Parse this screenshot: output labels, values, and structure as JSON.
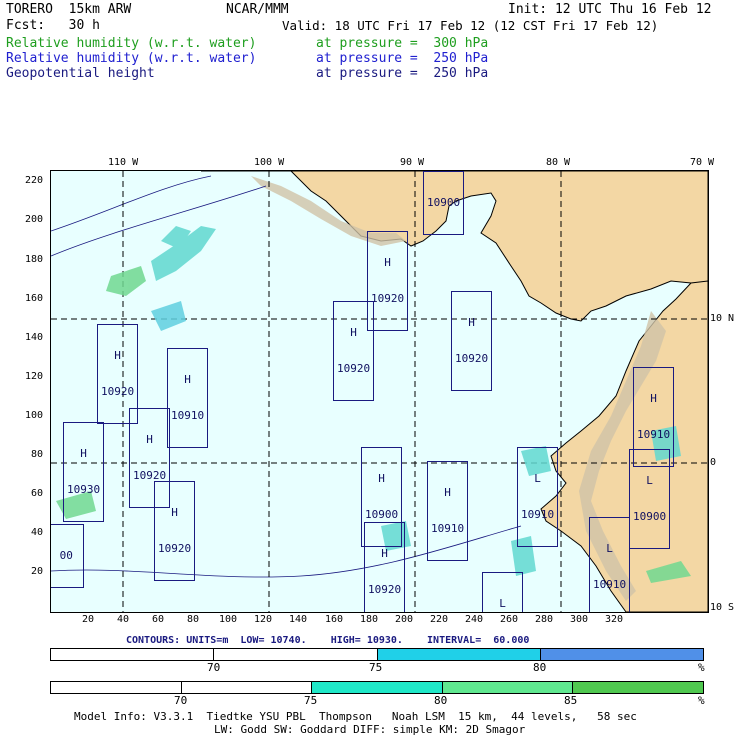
{
  "header": {
    "model": "TORERO  15km ARW",
    "org": "NCAR/MMM",
    "init": "Init: 12 UTC Thu 16 Feb 12",
    "fcst": "Fcst:   30 h",
    "valid": "Valid: 18 UTC Fri 17 Feb 12 (12 CST Fri 17 Feb 12)",
    "fields": [
      {
        "name": "Relative humidity (w.r.t. water)",
        "level": "at pressure =  300 hPa",
        "color": "#1e9e1e"
      },
      {
        "name": "Relative humidity (w.r.t. water)",
        "level": "at pressure =  250 hPa",
        "color": "#2020d0"
      },
      {
        "name": "Geopotential height",
        "level": "at pressure =  250 hPa",
        "color": "#1a1a80"
      }
    ]
  },
  "map": {
    "lon_labels": [
      "110 W",
      "100 W",
      "90 W",
      "80 W",
      "70 W"
    ],
    "lat_labels": [
      "10 N",
      "0",
      "10 S"
    ],
    "y_ticks": [
      "220",
      "200",
      "180",
      "160",
      "140",
      "120",
      "100",
      "80",
      "60",
      "40",
      "20"
    ],
    "x_ticks": [
      "20",
      "40",
      "60",
      "80",
      "100",
      "120",
      "140",
      "160",
      "180",
      "200",
      "220",
      "240",
      "260",
      "280",
      "300",
      "320"
    ],
    "colors": {
      "ocean": "#e8ffff",
      "land": "#f3d7a4",
      "mountain": "#c8b89a",
      "grid": "#000000",
      "contour": "#1a1a80"
    },
    "labels": [
      {
        "kind": "H",
        "value": "10900"
      },
      {
        "kind": "H",
        "value": "10920"
      },
      {
        "kind": "H",
        "value": "10920"
      },
      {
        "kind": "H",
        "value": "10920"
      },
      {
        "kind": "H",
        "value": "10920"
      },
      {
        "kind": "H",
        "value": "10910"
      },
      {
        "kind": "H",
        "value": "10920"
      },
      {
        "kind": "H",
        "value": "10930"
      },
      {
        "kind": "H",
        "value": "10910"
      },
      {
        "kind": "H",
        "value": "10900"
      },
      {
        "kind": "H",
        "value": "10910"
      },
      {
        "kind": "L",
        "value": "10910"
      },
      {
        "kind": "L",
        "value": "10900"
      },
      {
        "kind": "H",
        "value": "10920"
      },
      {
        "kind": "H",
        "value": "10920"
      },
      {
        "kind": "L",
        "value": "10910"
      },
      {
        "kind": "L",
        "value": "10910"
      },
      {
        "kind": "",
        "value": "00"
      }
    ]
  },
  "contours": {
    "text": "CONTOURS: UNITS=m  LOW= 10740.    HIGH= 10930.    INTERVAL=  60.000"
  },
  "colorbars": [
    {
      "segments": [
        {
          "from": 65,
          "to": 70,
          "color": "#ffffff"
        },
        {
          "from": 70,
          "to": 75,
          "color": "#ffffff"
        },
        {
          "from": 75,
          "to": 80,
          "color": "#20d0e8"
        },
        {
          "from": 80,
          "to": 85,
          "color": "#5090e8"
        }
      ],
      "labels": [
        "70",
        "75",
        "80",
        "%"
      ]
    },
    {
      "segments": [
        {
          "from": 65,
          "to": 70,
          "color": "#ffffff"
        },
        {
          "from": 70,
          "to": 75,
          "color": "#ffffff"
        },
        {
          "from": 75,
          "to": 80,
          "color": "#20e8c8"
        },
        {
          "from": 80,
          "to": 85,
          "color": "#60e890"
        },
        {
          "from": 85,
          "to": 90,
          "color": "#50c850"
        }
      ],
      "labels": [
        "70",
        "75",
        "80",
        "85",
        "%"
      ]
    }
  ],
  "footer": {
    "line1": "Model Info: V3.3.1  Tiedtke YSU PBL  Thompson   Noah LSM  15 km,  44 levels,   58 sec",
    "line2": "LW: Godd SW: Goddard DIFF: simple KM: 2D Smagor"
  }
}
